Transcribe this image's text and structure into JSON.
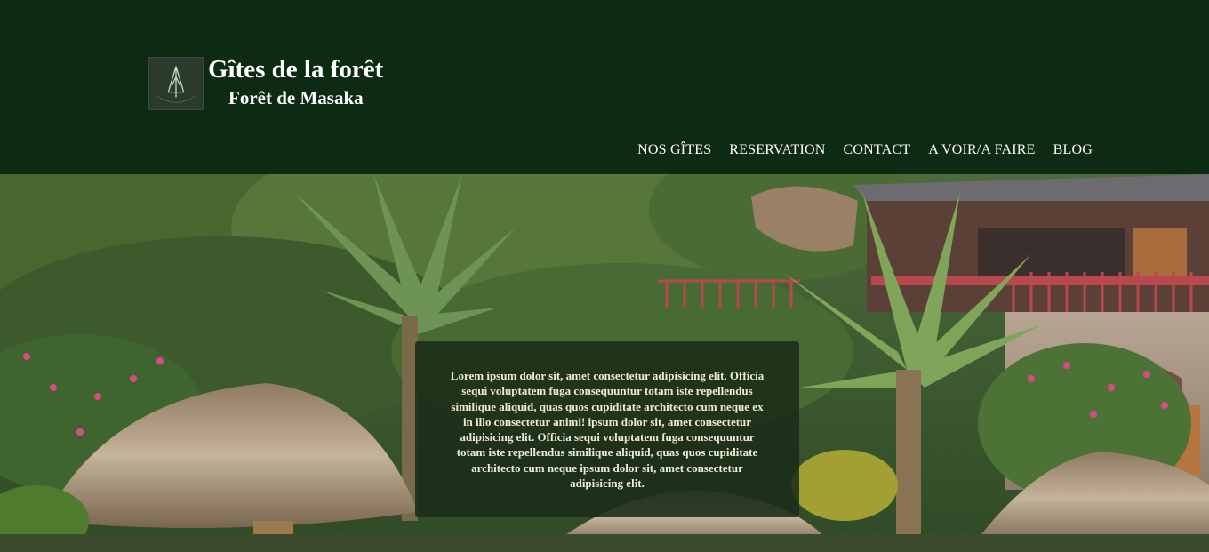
{
  "header": {
    "title": "Gîtes de la forêt",
    "subtitle": "Forêt de Masaka",
    "logo_icon": "pine-tree-icon",
    "colors": {
      "background": "#0d2a13",
      "text": "#ffffff"
    }
  },
  "nav": {
    "items": [
      {
        "label": "NOS GÎTES"
      },
      {
        "label": "RESERVATION"
      },
      {
        "label": "CONTACT"
      },
      {
        "label": "A VOIR/A FAIRE"
      },
      {
        "label": "BLOG"
      }
    ]
  },
  "hero": {
    "image": "forest-lodge-photo",
    "text": "Lorem ipsum dolor sit, amet consectetur adipisicing elit. Officia sequi voluptatem fuga consequuntur totam iste repellendus similique aliquid, quas quos cupiditate architecto cum neque ex in illo consectetur animi! ipsum dolor sit, amet consectetur adipisicing elit. Officia sequi voluptatem fuga consequuntur totam iste repellendus similique aliquid, quas quos cupiditate architecto cum neque ipsum dolor sit, amet consectetur adipisicing elit."
  }
}
